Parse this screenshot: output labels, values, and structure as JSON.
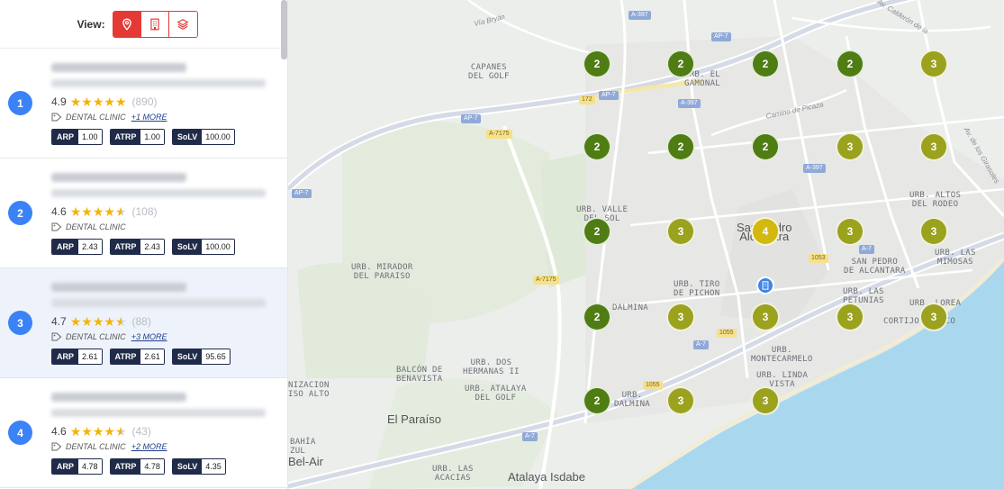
{
  "view": {
    "label": "View:",
    "modes": [
      {
        "icon": "map-pin-icon",
        "active": true
      },
      {
        "icon": "building-icon",
        "active": false
      },
      {
        "icon": "layers-icon",
        "active": false
      }
    ]
  },
  "results": [
    {
      "rank": "1",
      "rating": "4.9",
      "stars": 5,
      "reviews": "(890)",
      "category": "DENTAL CLINIC",
      "more": "+1 MORE",
      "arp": "1.00",
      "atrp": "1.00",
      "solv": "100.00",
      "selected": false
    },
    {
      "rank": "2",
      "rating": "4.6",
      "stars": 4.5,
      "reviews": "(108)",
      "category": "DENTAL CLINIC",
      "more": "",
      "arp": "2.43",
      "atrp": "2.43",
      "solv": "100.00",
      "selected": false
    },
    {
      "rank": "3",
      "rating": "4.7",
      "stars": 4.5,
      "reviews": "(88)",
      "category": "DENTAL CLINIC",
      "more": "+3 MORE",
      "arp": "2.61",
      "atrp": "2.61",
      "solv": "95.65",
      "selected": true
    },
    {
      "rank": "4",
      "rating": "4.6",
      "stars": 4.5,
      "reviews": "(43)",
      "category": "DENTAL CLINIC",
      "more": "+2 MORE",
      "arp": "4.78",
      "atrp": "4.78",
      "solv": "4.35",
      "selected": false
    }
  ],
  "metric_labels": {
    "arp": "ARP",
    "atrp": "ATRP",
    "solv": "SoLV"
  },
  "map": {
    "places": [
      {
        "name": "CAPANES\nDEL GOLF"
      },
      {
        "name": "URB. EL\nGAMONAL"
      },
      {
        "name": "URB. VALLE\nDEL SOL"
      },
      {
        "name": "URB. MIRADOR\nDEL PARAISO"
      },
      {
        "name": "URB. TIRO\nDE PICHON"
      },
      {
        "name": "URB. ALTOS\nDEL RODEO"
      },
      {
        "name": "SAN PEDRO\nDE ALCANTARA"
      },
      {
        "name": "URB. LAS\nMIMOSAS"
      },
      {
        "name": "URB. LAS\nPETUNIAS"
      },
      {
        "name": "URB. LOREA"
      },
      {
        "name": "CORTIJO BLANCO"
      },
      {
        "name": "DALMINA"
      },
      {
        "name": "URB.\nMONTECARMELO"
      },
      {
        "name": "URB. LINDA\nVISTA"
      },
      {
        "name": "URB. DOS\nHERMANAS II"
      },
      {
        "name": "BALCÓN DE\nBENAVISTA"
      },
      {
        "name": "URB. ATALAYA\nDEL GOLF"
      },
      {
        "name": "URB.\nDALMINA"
      },
      {
        "name": "NIZACION\nISO ALTO"
      },
      {
        "name": "BAHÍA\nZUL"
      },
      {
        "name": "URB. LAS\nACACIAS"
      },
      {
        "name": "San Pedro\nAlcántara"
      },
      {
        "name": "El Paraíso"
      },
      {
        "name": "Bel-Air"
      },
      {
        "name": "Atalaya Isdabe"
      }
    ],
    "roads": [
      {
        "name": "Vía Bryán"
      },
      {
        "name": "Camino de Picaza"
      },
      {
        "name": "Av. Calderón de la"
      },
      {
        "name": "Av. de los Girasoles"
      }
    ],
    "shields": [
      {
        "text": "A-397",
        "color": "blue"
      },
      {
        "text": "AP-7",
        "color": "blue"
      },
      {
        "text": "172",
        "color": "yellow"
      },
      {
        "text": "AP-7",
        "color": "blue"
      },
      {
        "text": "A-397",
        "color": "blue"
      },
      {
        "text": "AP-7",
        "color": "blue"
      },
      {
        "text": "A-7175",
        "color": "yellow"
      },
      {
        "text": "A-397",
        "color": "blue"
      },
      {
        "text": "AP-7",
        "color": "blue"
      },
      {
        "text": "A-7175",
        "color": "yellow"
      },
      {
        "text": "A-7",
        "color": "blue"
      },
      {
        "text": "1053",
        "color": "yellow"
      },
      {
        "text": "1055",
        "color": "yellow"
      },
      {
        "text": "A-7",
        "color": "blue"
      },
      {
        "text": "1055",
        "color": "yellow"
      },
      {
        "text": "A-7",
        "color": "blue"
      }
    ],
    "markers": [
      {
        "value": "2",
        "color": "dark"
      },
      {
        "value": "2",
        "color": "dark"
      },
      {
        "value": "2",
        "color": "dark"
      },
      {
        "value": "2",
        "color": "dark"
      },
      {
        "value": "3",
        "color": "olive"
      },
      {
        "value": "2",
        "color": "dark"
      },
      {
        "value": "2",
        "color": "dark"
      },
      {
        "value": "2",
        "color": "dark"
      },
      {
        "value": "3",
        "color": "olive"
      },
      {
        "value": "3",
        "color": "olive"
      },
      {
        "value": "2",
        "color": "dark"
      },
      {
        "value": "3",
        "color": "olive"
      },
      {
        "value": "4",
        "color": "gold"
      },
      {
        "value": "3",
        "color": "olive"
      },
      {
        "value": "3",
        "color": "olive"
      },
      {
        "value": "2",
        "color": "dark"
      },
      {
        "value": "3",
        "color": "olive"
      },
      {
        "value": "3",
        "color": "olive"
      },
      {
        "value": "3",
        "color": "olive"
      },
      {
        "value": "3",
        "color": "olive"
      },
      {
        "value": "2",
        "color": "dark"
      },
      {
        "value": "3",
        "color": "olive"
      },
      {
        "value": "3",
        "color": "olive"
      }
    ],
    "colors": {
      "dark": "#4f7d14",
      "olive": "#9aa21e",
      "gold": "#d2b80f",
      "rank": "#3b82f6",
      "accent": "#e53935",
      "sea": "#a9d8ee"
    }
  }
}
